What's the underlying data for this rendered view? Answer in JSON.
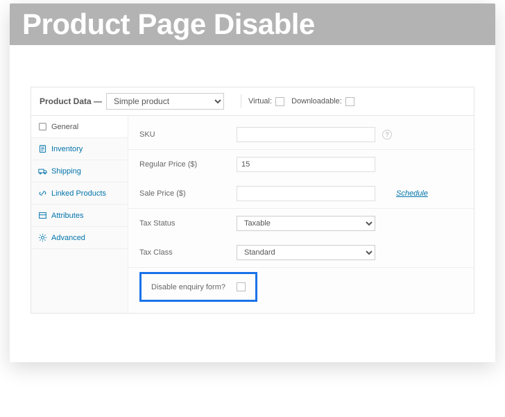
{
  "banner": {
    "title": "Product Page Disable"
  },
  "panel": {
    "label": "Product Data —",
    "product_type": "Simple product",
    "virtual_label": "Virtual:",
    "downloadable_label": "Downloadable:"
  },
  "tabs": {
    "general": "General",
    "inventory": "Inventory",
    "shipping": "Shipping",
    "linked": "Linked Products",
    "attributes": "Attributes",
    "advanced": "Advanced"
  },
  "fields": {
    "sku_label": "SKU",
    "sku_value": "",
    "regular_price_label": "Regular Price ($)",
    "regular_price_value": "15",
    "sale_price_label": "Sale Price ($)",
    "sale_price_value": "",
    "schedule_label": "Schedule",
    "tax_status_label": "Tax Status",
    "tax_status_value": "Taxable",
    "tax_class_label": "Tax Class",
    "tax_class_value": "Standard",
    "disable_enquiry_label": "Disable enquiry form?"
  }
}
